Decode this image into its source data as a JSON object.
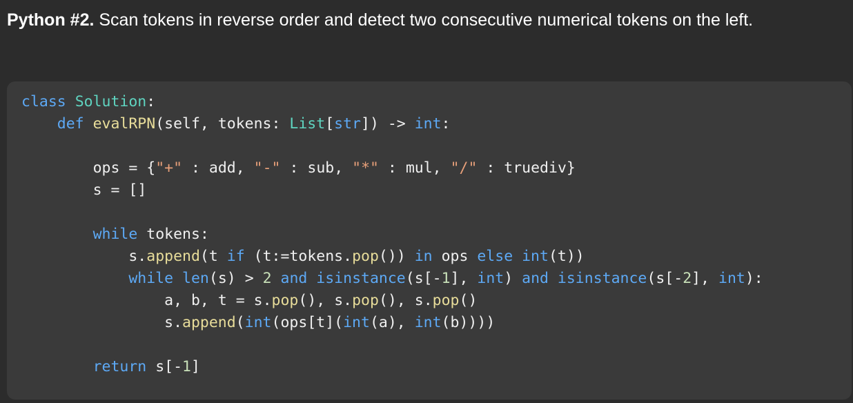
{
  "heading": {
    "lead": "Python #2.",
    "text": " Scan tokens in reverse order and detect two consecutive numerical tokens on the left."
  },
  "code": {
    "language": "python",
    "lines": [
      "class Solution:",
      "    def evalRPN(self, tokens: List[str]) -> int:",
      "",
      "        ops = {\"+\" : add, \"-\" : sub, \"*\" : mul, \"/\" : truediv}",
      "        s = []",
      "",
      "        while tokens:",
      "            s.append(t if (t:=tokens.pop()) in ops else int(t))",
      "            while len(s) > 2 and isinstance(s[-1], int) and isinstance(s[-2], int):",
      "                a, b, t = s.pop(), s.pop(), s.pop()",
      "                s.append(int(ops[t](int(a), int(b))))",
      "",
      "        return s[-1]"
    ]
  },
  "colors": {
    "page_background": "#2c2c2c",
    "code_background": "#3a3a3a",
    "keyword": "#5da9f5",
    "class_name": "#5fd4c0",
    "function_name": "#e8dd9a",
    "string": "#e8a07a",
    "number": "#c8e0b8"
  }
}
